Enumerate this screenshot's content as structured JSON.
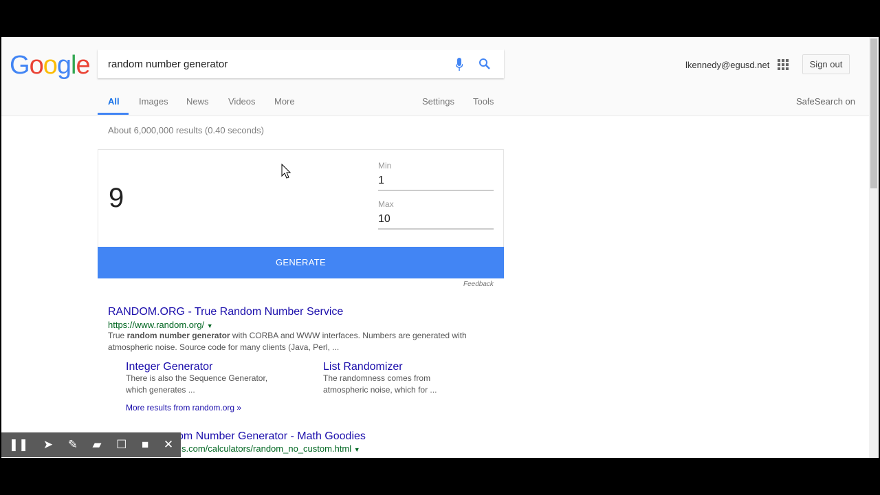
{
  "header": {
    "logo": "Google",
    "query": "random number generator",
    "user": "lkennedy@egusd.net",
    "signout": "Sign out",
    "safesearch": "SafeSearch on"
  },
  "tabs": [
    {
      "label": "All"
    },
    {
      "label": "Images"
    },
    {
      "label": "News"
    },
    {
      "label": "Videos"
    },
    {
      "label": "More"
    },
    {
      "label": "Settings"
    },
    {
      "label": "Tools"
    }
  ],
  "stats": "About 6,000,000 results (0.40 seconds)",
  "rng": {
    "result": "9",
    "min_label": "Min",
    "min": "1",
    "max_label": "Max",
    "max": "10",
    "button": "GENERATE",
    "feedback": "Feedback"
  },
  "results": [
    {
      "title": "RANDOM.ORG - True Random Number Service",
      "url": "https://www.random.org/",
      "snippet_pre": "True ",
      "snippet_bold": "random number generator",
      "snippet_post": " with CORBA and WWW interfaces. Numbers are generated with atmospheric noise. Source code for many clients (Java, Perl, ...",
      "sitelinks": [
        {
          "title": "Integer Generator",
          "text": "There is also the Sequence Generator, which generates ..."
        },
        {
          "title": "List Randomizer",
          "text": "The randomness comes from atmospheric noise, which for ..."
        }
      ],
      "more": "More results from random.org »"
    },
    {
      "title": "om Number Generator - Math Goodies",
      "url": "s.com/calculators/random_no_custom.html"
    }
  ]
}
